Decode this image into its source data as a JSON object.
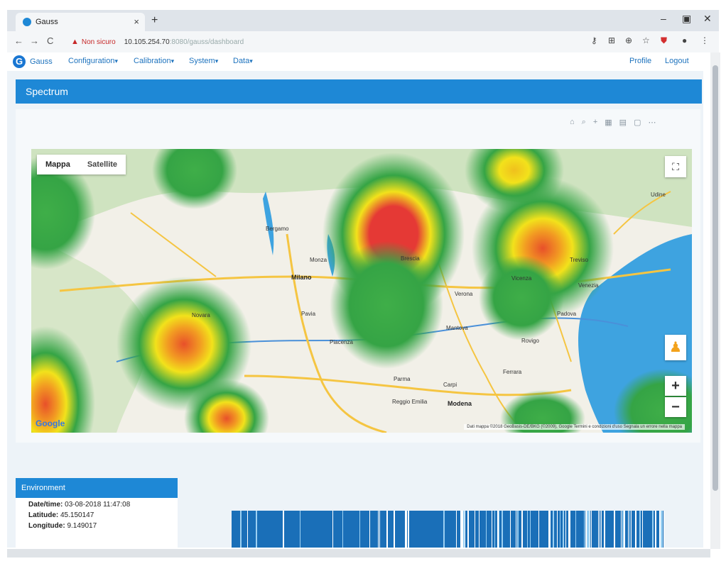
{
  "browser": {
    "tab_title": "Gauss",
    "tab_close": "×",
    "new_tab": "+",
    "win_min": "–",
    "win_max": "▣",
    "win_close": "✕",
    "back": "←",
    "forward": "→",
    "reload": "C",
    "not_secure": "Non sicuro",
    "url_host": "10.105.254.70",
    "url_path": ":8080/gauss/dashboard"
  },
  "appnav": {
    "logo": "G",
    "app_name": "Gauss",
    "menus": [
      "Configuration",
      "Calibration",
      "System",
      "Data"
    ],
    "profile": "Profile",
    "logout": "Logout"
  },
  "page": {
    "title": "Spectrum"
  },
  "map": {
    "type_buttons": [
      "Mappa",
      "Satellite"
    ],
    "attribution": "Dati mappa ©2018 GeoBasis-DE/BKG (©2009), Google   Termini e condizioni d'uso   Segnala un errore nella mappa",
    "google_label": "Google",
    "zoom_in": "+",
    "zoom_out": "−",
    "cities": [
      {
        "name": "Milano"
      },
      {
        "name": "Monza"
      },
      {
        "name": "Bergamo"
      },
      {
        "name": "Brescia"
      },
      {
        "name": "Verona"
      },
      {
        "name": "Vicenza"
      },
      {
        "name": "Padova"
      },
      {
        "name": "Venezia"
      },
      {
        "name": "Udine"
      },
      {
        "name": "Pavia"
      },
      {
        "name": "Piacenza"
      },
      {
        "name": "Parma"
      },
      {
        "name": "Reggio Emilia"
      },
      {
        "name": "Modena"
      },
      {
        "name": "Mantova"
      },
      {
        "name": "Ferrara"
      },
      {
        "name": "Rovigo"
      },
      {
        "name": "Novara"
      },
      {
        "name": "Treviso"
      },
      {
        "name": "Carpi"
      }
    ]
  },
  "environment": {
    "title": "Environment",
    "date_label": "Date/time:",
    "date_value": "03-08-2018 11:47:08",
    "lat_label": "Latitude:",
    "lat_value": "45.150147",
    "lon_label": "Longitude:",
    "lon_value": "9.149017"
  },
  "colors": {
    "accent": "#1e88d6",
    "heat_high": "#e53935",
    "heat_mid": "#f2e21b",
    "heat_low": "#2e9e3e"
  }
}
